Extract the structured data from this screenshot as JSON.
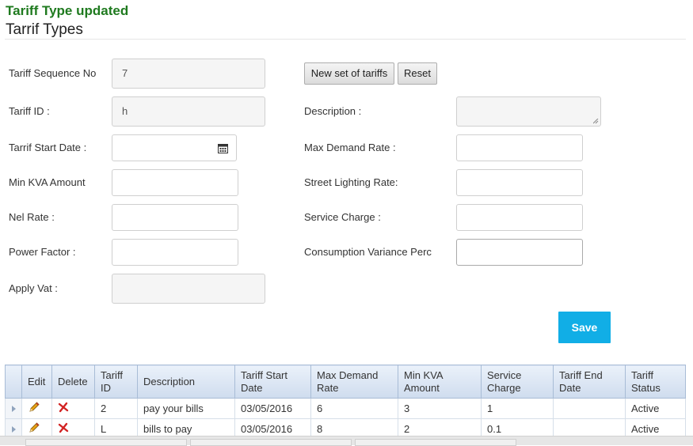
{
  "message": "Tariff Type updated",
  "page_title": "Tarrif Types",
  "form": {
    "seq_label": "Tariff Sequence No",
    "seq_value": "7",
    "tariff_id_label": "Tariff ID :",
    "tariff_id_value": "h",
    "start_date_label": "Tarrif Start Date :",
    "min_kva_label": "Min KVA Amount",
    "nel_rate_label": "Nel Rate :",
    "power_factor_label": "Power Factor :",
    "apply_vat_label": "Apply Vat :",
    "description_label": "Description :",
    "max_demand_label": "Max Demand Rate :",
    "street_lighting_label": "Street Lighting Rate:",
    "service_charge_label": "Service Charge :",
    "consumption_variance_label": "Consumption Variance Perc"
  },
  "buttons": {
    "new_set": "New set of tariffs",
    "reset": "Reset",
    "save": "Save"
  },
  "table": {
    "headers": [
      "Edit",
      "Delete",
      "Tariff ID",
      "Description",
      "Tariff Start Date",
      "Max Demand Rate",
      "Min KVA Amount",
      "Service Charge",
      "Tariff End Date",
      "Tariff Status"
    ],
    "rows": [
      {
        "tariff_id": "2",
        "description": "pay your bills",
        "start_date": "03/05/2016",
        "max_demand": "6",
        "min_kva": "3",
        "service_charge": "1",
        "end_date": "",
        "status": "Active"
      },
      {
        "tariff_id": "L",
        "description": "bills to pay",
        "start_date": "03/05/2016",
        "max_demand": "8",
        "min_kva": "2",
        "service_charge": "0.1",
        "end_date": "",
        "status": "Active"
      }
    ]
  },
  "icons": {
    "edit": "pencil-icon",
    "delete": "red-x-icon",
    "calendar": "calendar-icon",
    "row_selector": "triangle-right-icon"
  },
  "colors": {
    "success": "#1f7a1f",
    "save_button": "#11aee6",
    "delete_icon": "#d22323"
  }
}
